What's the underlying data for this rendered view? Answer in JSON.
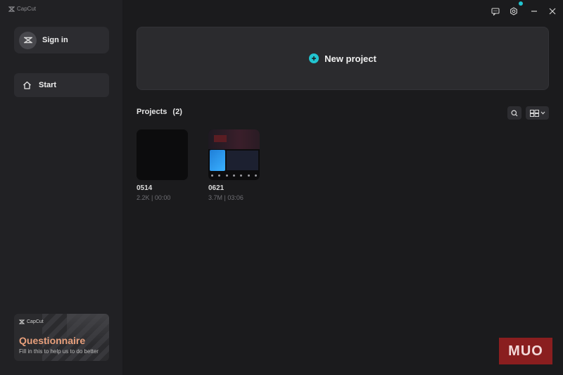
{
  "app": {
    "title": "CapCut"
  },
  "sidebar": {
    "sign_in_label": "Sign in",
    "start_label": "Start",
    "questionnaire": {
      "logo_text": "CapCut",
      "title": "Questionnaire",
      "subtitle": "Fill in this to help us to do better"
    }
  },
  "main": {
    "new_project_label": "New project",
    "projects_header": "Projects",
    "projects_count": "(2)",
    "projects": [
      {
        "name": "0514",
        "meta": "2.2K | 00:00"
      },
      {
        "name": "0621",
        "meta": "3.7M | 03:06"
      }
    ]
  },
  "watermark": {
    "text": "MUO"
  },
  "colors": {
    "accent": "#22c4d0",
    "background": "#1b1b1d",
    "sidebar": "#212124",
    "questionnaire_title": "#e9a07c",
    "watermark_bg": "#8a1e1f"
  },
  "icons": {
    "window": [
      "feedback-icon",
      "settings-icon",
      "minimize-icon",
      "close-icon"
    ],
    "main": [
      "plus-circle-icon",
      "search-icon",
      "grid-view-icon",
      "chevron-down-icon"
    ],
    "sidebar": [
      "capcut-logo-icon",
      "home-icon"
    ]
  }
}
